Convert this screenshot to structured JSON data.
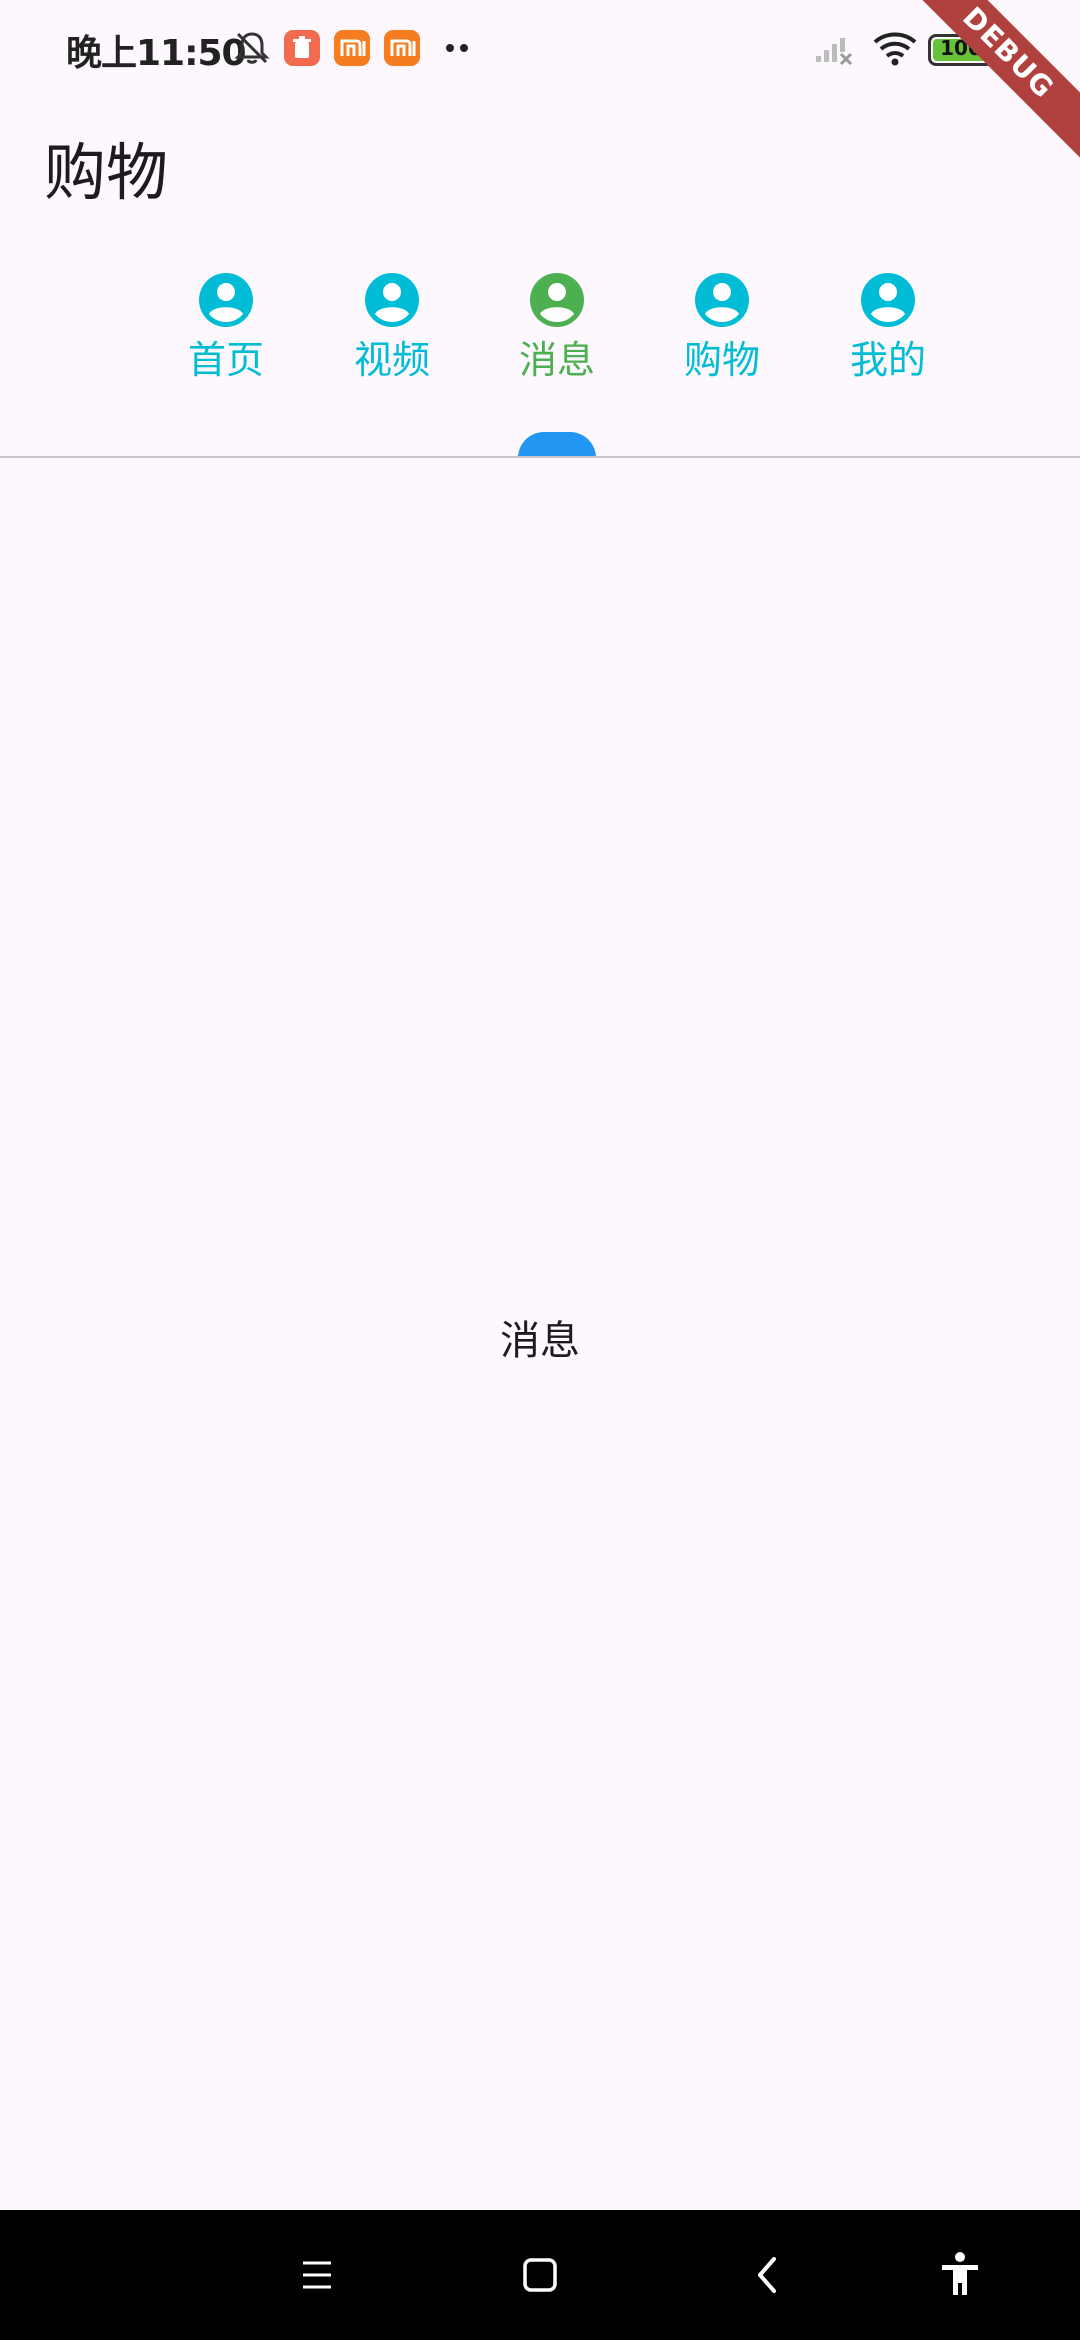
{
  "status_bar": {
    "time": "晚上11:50",
    "battery_level": 100,
    "battery_text": "100",
    "icons": [
      "mute-icon",
      "app-badge-trash",
      "mi-icon",
      "mi-icon",
      "more-dots-icon",
      "signal-off-icon",
      "wifi-icon",
      "battery-icon",
      "charging-icon"
    ],
    "badge_colors": [
      "#f26b4e",
      "#f57c1f",
      "#f57c1f"
    ]
  },
  "debug_banner": "DEBUG",
  "app_bar": {
    "title": "购物"
  },
  "tabs": {
    "selected_index": 2,
    "active_color": "#4caf50",
    "inactive_color": "#00bcd4",
    "indicator_color": "#2196f3",
    "items": [
      {
        "label": "首页",
        "icon": "account-circle-icon"
      },
      {
        "label": "视频",
        "icon": "account-circle-icon"
      },
      {
        "label": "消息",
        "icon": "account-circle-icon"
      },
      {
        "label": "购物",
        "icon": "account-circle-icon"
      },
      {
        "label": "我的",
        "icon": "account-circle-icon"
      }
    ]
  },
  "content": {
    "text": "消息"
  },
  "nav_bar": {
    "buttons": [
      "menu-icon",
      "home-icon",
      "back-icon",
      "accessibility-icon"
    ]
  }
}
